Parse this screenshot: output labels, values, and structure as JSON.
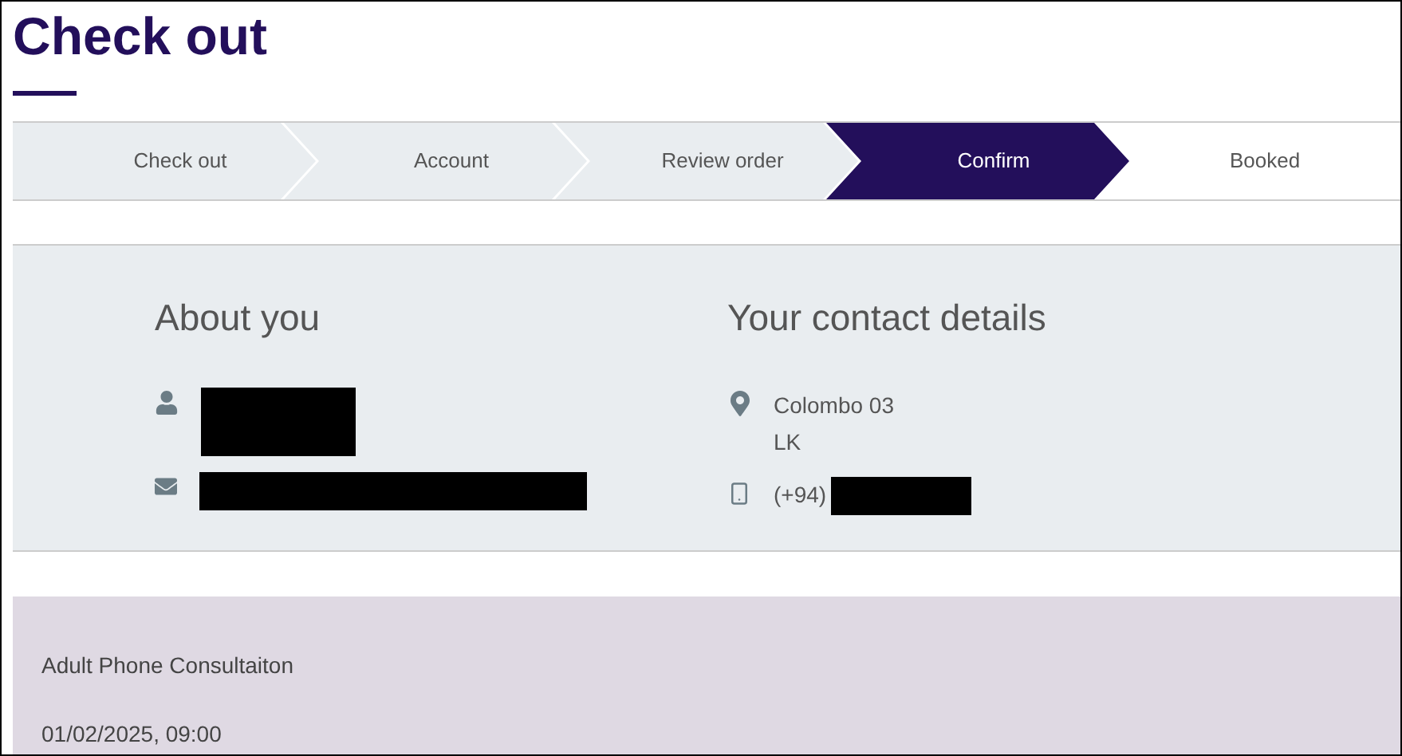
{
  "title": "Check out",
  "steps": [
    {
      "label": "Check out",
      "selected": false,
      "completed": true
    },
    {
      "label": "Account",
      "selected": false,
      "completed": true
    },
    {
      "label": "Review order",
      "selected": false,
      "completed": true
    },
    {
      "label": "Confirm",
      "selected": true
    },
    {
      "label": "Booked",
      "selected": false,
      "completed": false
    }
  ],
  "about_you": {
    "heading": "About you",
    "items": [
      {
        "kind": "person",
        "redacted": true
      },
      {
        "kind": "email",
        "redacted": true
      }
    ]
  },
  "contact": {
    "heading": "Your contact details",
    "items": [
      {
        "kind": "location",
        "lines": [
          "Colombo 03",
          "LK"
        ]
      },
      {
        "kind": "phone",
        "text": "(+94)",
        "redacted": true
      }
    ]
  },
  "booking": {
    "service": "Adult Phone Consultaiton",
    "datetime": "01/02/2025, 09:00"
  }
}
